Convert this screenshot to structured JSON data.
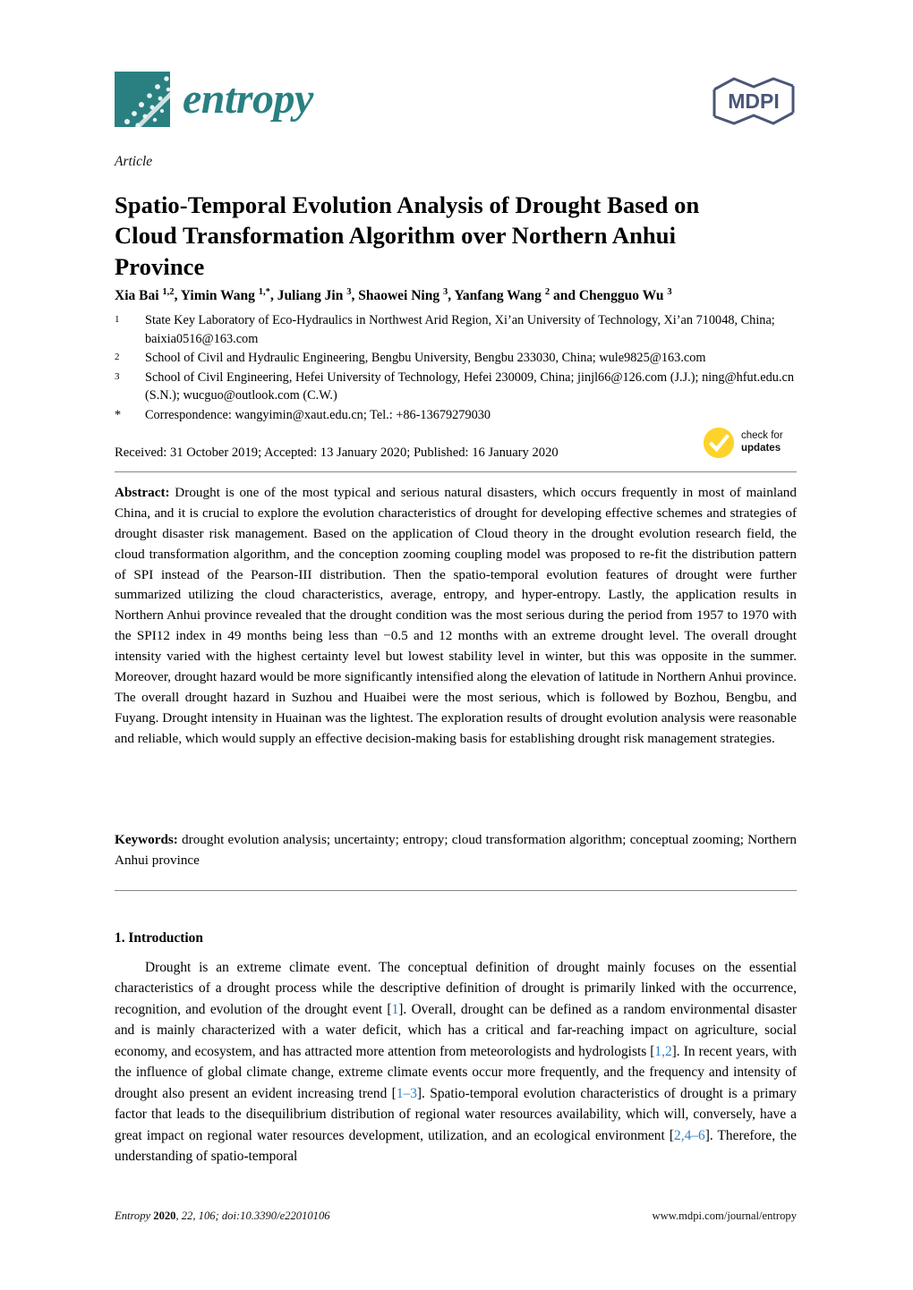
{
  "masthead": {
    "journal_name": "entropy",
    "journal_logo_icon": "entropy-scatter-logo",
    "publisher_logo_text": "MDPI",
    "publisher_logo_icon": "mdpi-hexagon-logo",
    "brand_color": "#2a8081"
  },
  "article": {
    "type_label": "Article",
    "title": "Spatio-Temporal Evolution Analysis of Drought Based on Cloud Transformation Algorithm over Northern Anhui Province",
    "authors": "Xia Bai 1,2, Yimin Wang 1,*, Juliang Jin 3, Shaowei Ning 3, Yanfang Wang 2 and Chengguo Wu 3",
    "authors_parts": [
      {
        "name": "Xia Bai ",
        "sup": "1,2",
        "sep": ", "
      },
      {
        "name": "Yimin Wang ",
        "sup": "1,*",
        "sep": ", "
      },
      {
        "name": "Juliang Jin ",
        "sup": "3",
        "sep": ", "
      },
      {
        "name": "Shaowei Ning ",
        "sup": "3",
        "sep": ", "
      },
      {
        "name": "Yanfang Wang ",
        "sup": "2",
        "sep": " and "
      },
      {
        "name": "Chengguo Wu ",
        "sup": "3",
        "sep": ""
      }
    ],
    "affiliations": [
      {
        "marker": "1",
        "text": "State Key Laboratory of Eco-Hydraulics in Northwest Arid Region, Xi’an University of Technology, Xi’an 710048, China; baixia0516@163.com"
      },
      {
        "marker": "2",
        "text": "School of Civil and Hydraulic Engineering, Bengbu University, Bengbu 233030, China; wule9825@163.com"
      },
      {
        "marker": "3",
        "text": "School of Civil Engineering, Hefei University of Technology, Hefei 230009, China; jinjl66@126.com (J.J.); ning@hfut.edu.cn (S.N.); wucguo@outlook.com (C.W.)"
      },
      {
        "marker": "*",
        "text": "Correspondence: wangyimin@xaut.edu.cn; Tel.: +86-13679279030"
      }
    ],
    "publication_dates": "Received: 31 October 2019; Accepted: 13 January 2020; Published: 16 January 2020"
  },
  "crossmark": {
    "line1": "check for",
    "line2": "updates",
    "icon": "yellow-check-circle-icon",
    "color": "#fdd32b"
  },
  "abstract": {
    "label": "Abstract:",
    "text": " Drought is one of the most typical and serious natural disasters, which occurs frequently in most of mainland China, and it is crucial to explore the evolution characteristics of drought for developing effective schemes and strategies of drought disaster risk management. Based on the application of Cloud theory in the drought evolution research field, the cloud transformation algorithm, and the conception zooming coupling model was proposed to re-fit the distribution pattern of SPI instead of the Pearson-III distribution. Then the spatio-temporal evolution features of drought were further summarized utilizing the cloud characteristics, average, entropy, and hyper-entropy. Lastly, the application results in Northern Anhui province revealed that the drought condition was the most serious during the period from 1957 to 1970 with the SPI12 index in 49 months being less than −0.5 and 12 months with an extreme drought level. The overall drought intensity varied with the highest certainty level but lowest stability level in winter, but this was opposite in the summer. Moreover, drought hazard would be more significantly intensified along the elevation of latitude in Northern Anhui province. The overall drought hazard in Suzhou and Huaibei were the most serious, which is followed by Bozhou, Bengbu, and Fuyang. Drought intensity in Huainan was the lightest. The exploration results of drought evolution analysis were reasonable and reliable, which would supply an effective decision-making basis for establishing drought risk management strategies."
  },
  "keywords": {
    "label": "Keywords:",
    "text": "  drought evolution analysis; uncertainty; entropy; cloud transformation algorithm; conceptual zooming; Northern Anhui province"
  },
  "introduction": {
    "heading": "1. Introduction",
    "paragraph_segments": [
      {
        "type": "text",
        "value": "Drought is an extreme climate event. The conceptual definition of drought mainly focuses on the essential characteristics of a drought process while the descriptive definition of drought is primarily linked with the occurrence, recognition, and evolution of the drought event ["
      },
      {
        "type": "cite",
        "value": "1"
      },
      {
        "type": "text",
        "value": "]. Overall, drought can be defined as a random environmental disaster and is mainly characterized with a water deficit, which has a critical and far-reaching impact on agriculture, social economy, and ecosystem, and has attracted more attention from meteorologists and hydrologists ["
      },
      {
        "type": "cite",
        "value": "1,2"
      },
      {
        "type": "text",
        "value": "]. In recent years, with the influence of global climate change, extreme climate events occur more frequently, and the frequency and intensity of drought also present an evident increasing trend ["
      },
      {
        "type": "cite",
        "value": "1–3"
      },
      {
        "type": "text",
        "value": "]. Spatio-temporal evolution characteristics of drought is a primary factor that leads to the disequilibrium distribution of regional water resources availability, which will, conversely, have a great impact on regional water resources development, utilization, and an ecological environment ["
      },
      {
        "type": "cite",
        "value": "2,4–6"
      },
      {
        "type": "text",
        "value": "]. Therefore, the understanding of spatio-temporal"
      }
    ],
    "citation_color": "#2d7fc1"
  },
  "footer": {
    "journal_italic": "Entropy",
    "year": "2020",
    "volume_issue": ", 22, 106; doi:10.3390/e22010106",
    "url": "www.mdpi.com/journal/entropy"
  }
}
